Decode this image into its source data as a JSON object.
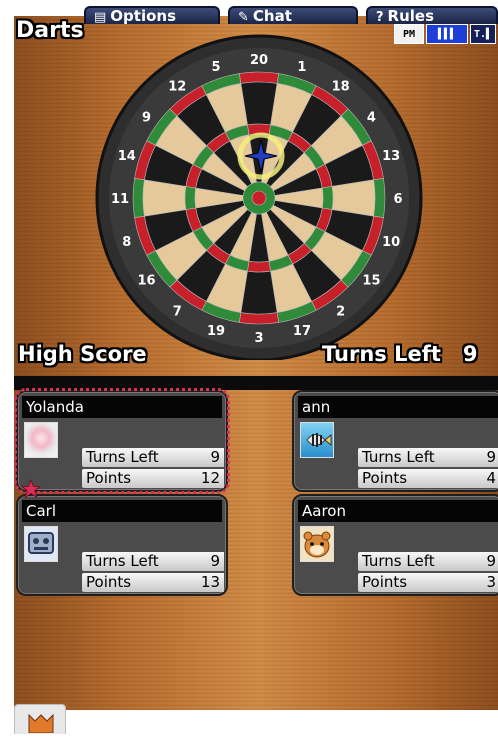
{
  "header": {
    "title": "Darts",
    "status": {
      "clock": "PM",
      "signal": "▌▌▌",
      "battery": "T.▌"
    }
  },
  "dartboard": {
    "numbers": [
      "20",
      "1",
      "18",
      "4",
      "13",
      "6",
      "10",
      "15",
      "2",
      "17",
      "3",
      "19",
      "7",
      "16",
      "8",
      "11",
      "14",
      "9",
      "12",
      "5"
    ],
    "colors": {
      "dark": "#1a1a1a",
      "light": "#e6c99a",
      "red": "#c8202a",
      "green": "#2f8a3a",
      "rim": "#2e2e2e"
    }
  },
  "scoreboard": {
    "high_score_label": "High Score",
    "turns_left_label": "Turns Left",
    "turns_left_value": "9"
  },
  "players": [
    {
      "name": "Yolanda",
      "avatar": "rose-icon",
      "turns_label": "Turns Left",
      "turns": "9",
      "points_label": "Points",
      "points": "12",
      "active": true
    },
    {
      "name": "ann",
      "avatar": "fish-icon",
      "turns_label": "Turns Left",
      "turns": "9",
      "points_label": "Points",
      "points": "4",
      "active": false
    },
    {
      "name": "Carl",
      "avatar": "robot-icon",
      "turns_label": "Turns Left",
      "turns": "9",
      "points_label": "Points",
      "points": "13",
      "active": false
    },
    {
      "name": "Aaron",
      "avatar": "hamster-icon",
      "turns_label": "Turns Left",
      "turns": "9",
      "points_label": "Points",
      "points": "3",
      "active": false
    }
  ],
  "tabs": {
    "options": "Options",
    "chat": "Chat",
    "rules": "Rules"
  },
  "accent": {
    "active_outline": "#d9305a",
    "tab_bg": "#24305a"
  }
}
